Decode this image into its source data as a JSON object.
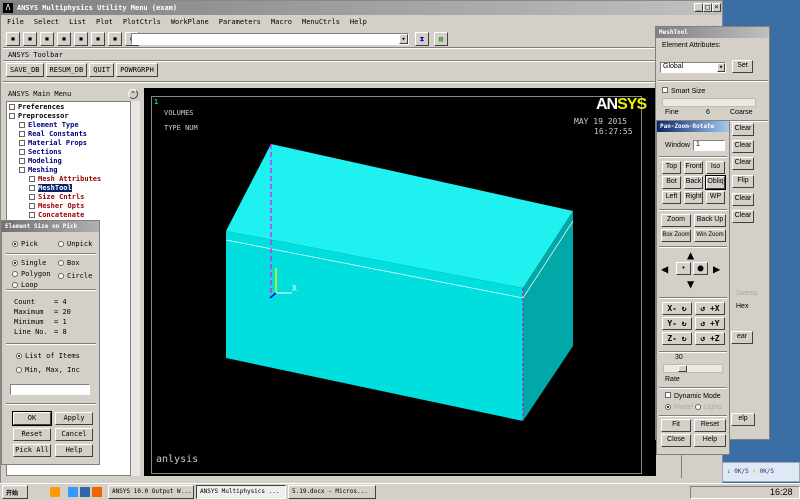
{
  "window": {
    "title": "ANSYS Multiphysics Utility Menu (exam)"
  },
  "menu": [
    "File",
    "Select",
    "List",
    "Plot",
    "PlotCtrls",
    "WorkPlane",
    "Parameters",
    "Macro",
    "MenuCtrls",
    "Help"
  ],
  "toolbar_label": "ANSYS Toolbar",
  "toolbar_buttons": [
    "SAVE_DB",
    "RESUM_DB",
    "QUIT",
    "POWRGRPH"
  ],
  "command_input": "",
  "main_menu": {
    "title": "ANSYS Main Menu",
    "items": [
      {
        "label": "Preferences",
        "color": "#000000"
      },
      {
        "label": "Preprocessor",
        "color": "#000000"
      },
      {
        "label": "Element Type",
        "color": "#000080"
      },
      {
        "label": "Real Constants",
        "color": "#000080"
      },
      {
        "label": "Material Props",
        "color": "#000080"
      },
      {
        "label": "Sections",
        "color": "#000080"
      },
      {
        "label": "Modeling",
        "color": "#000080"
      },
      {
        "label": "Meshing",
        "color": "#000080"
      },
      {
        "label": "Mesh Attributes",
        "color": "#a00000"
      },
      {
        "label": "MeshTool",
        "color": "#ffffff"
      },
      {
        "label": "Size Cntrls",
        "color": "#a00000"
      },
      {
        "label": "Mesher Opts",
        "color": "#a00000"
      },
      {
        "label": "Concatenate",
        "color": "#a00000"
      }
    ]
  },
  "pick_dialog": {
    "title": "Element Size on Pick",
    "pick": "Pick",
    "unpick": "Unpick",
    "single": "Single",
    "box": "Box",
    "polygon": "Polygon",
    "circle": "Circle",
    "loop": "Loop",
    "stats": [
      {
        "k": "Count",
        "v": "4"
      },
      {
        "k": "Maximum",
        "v": "20"
      },
      {
        "k": "Minimum",
        "v": "1"
      },
      {
        "k": "Line No.",
        "v": "8"
      }
    ],
    "list_items": "List of Items",
    "min_max_inc": "Min, Max, Inc",
    "input": "",
    "ok": "OK",
    "apply": "Apply",
    "reset": "Reset",
    "cancel": "Cancel",
    "pick_all": "Pick All",
    "help": "Help"
  },
  "graphics": {
    "window_num": "1",
    "line1": "VOLUMES",
    "line2": "TYPE NUM",
    "logo_an": "AN",
    "logo_sys": "SYS",
    "date": "MAY 19 2015",
    "time": "16:27:55",
    "axis_x": "X",
    "caption": "anlysis"
  },
  "meshtool": {
    "title": "MeshTool",
    "elem_attr": "Element Attributes:",
    "attr_value": "Global",
    "set": "Set",
    "smart_size": "Smart Size",
    "fine": "Fine",
    "value": "6",
    "coarse": "Coarse",
    "clear": "Clear",
    "flip": "Flip",
    "hex": "Hex",
    "sweep": "Sweep",
    "ear": "ear",
    "help_partial": "elp"
  },
  "pzr": {
    "title": "Pan-Zoom-Rotate",
    "window_label": "Window",
    "window_value": "1",
    "views": [
      "Top",
      "Front",
      "Iso",
      "Bot",
      "Back",
      "Obliq",
      "Left",
      "Right",
      "WP"
    ],
    "zoom": "Zoom",
    "back_up": "Back Up",
    "box_zoom": "Box Zoom",
    "win_zoom": "Win Zoom",
    "rot": [
      "X- ↻",
      "↺ +X",
      "Y- ↻",
      "↺ +Y",
      "Z- ↻",
      "↺ +Z"
    ],
    "rate_value": "30",
    "rate": "Rate",
    "rate_fraction": 0.15,
    "dynamic": "Dynamic Mode",
    "model": "Model",
    "lights": "Lights",
    "fit": "Fit",
    "reset": "Reset",
    "close": "Close",
    "help": "Help"
  },
  "taskbar": {
    "start": "开始",
    "tasks": [
      "ANSYS 10.0 Output W...",
      "ANSYS Multiphysics ...",
      "5.19.docx - Micros..."
    ],
    "clock": "16:28",
    "down": "0K/S",
    "up": "0K/S"
  },
  "colors": {
    "front": "#00dede",
    "top": "#1ff0f0",
    "side": "#00a8a8",
    "accent": "#0a246a"
  }
}
